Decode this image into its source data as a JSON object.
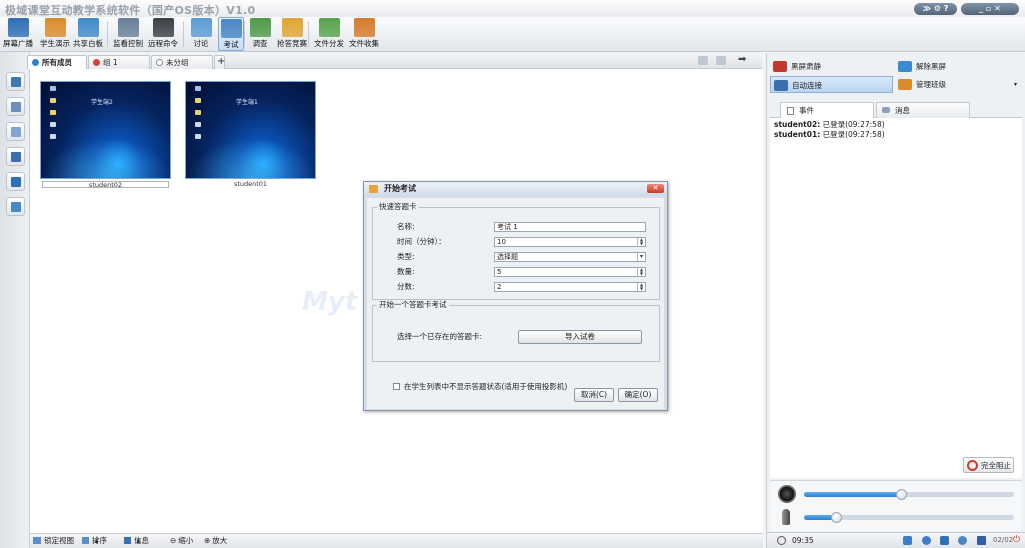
{
  "app": {
    "title": "极域课堂互动教学系统软件（国产OS版本）V1.0"
  },
  "window_controls": [
    {
      "name": "collapse-icon",
      "glyph": "≫"
    },
    {
      "name": "gear-icon",
      "glyph": "⚙"
    },
    {
      "name": "help-icon",
      "glyph": "?"
    },
    {
      "name": "minimize-icon",
      "glyph": "_"
    },
    {
      "name": "restore-icon",
      "glyph": "▫"
    },
    {
      "name": "close-icon",
      "glyph": "✕"
    }
  ],
  "toolbar": {
    "items": [
      {
        "label": "屏幕广播",
        "icon": "broadcast-icon",
        "color": "#2f6fb5"
      },
      {
        "label": "学生演示",
        "icon": "student-demo-icon",
        "color": "#d98b2b"
      },
      {
        "label": "共享白板",
        "icon": "whiteboard-icon",
        "color": "#3d8ac9"
      },
      {
        "label": "监看控制",
        "icon": "monitor-control-icon",
        "color": "#6a7f96"
      },
      {
        "label": "远程命令",
        "icon": "remote-command-icon",
        "color": "#3b4046"
      },
      {
        "label": "讨论",
        "icon": "discussion-icon",
        "color": "#5b9bd5"
      },
      {
        "label": "考试",
        "icon": "exam-icon",
        "color": "#4b86c7"
      },
      {
        "label": "调查",
        "icon": "survey-icon",
        "color": "#4e9a48"
      },
      {
        "label": "抢答竞赛",
        "icon": "quiz-icon",
        "color": "#e0a531"
      },
      {
        "label": "文件分发",
        "icon": "file-send-icon",
        "color": "#58a34c"
      },
      {
        "label": "文件收集",
        "icon": "file-collect-icon",
        "color": "#d67a2c"
      }
    ]
  },
  "tabs": [
    {
      "label": "所有成员",
      "color": "#2f7fd0"
    },
    {
      "label": "组 1",
      "color": "#d9413a"
    },
    {
      "label": "未分组",
      "color": "#8a8f96"
    }
  ],
  "tab_add": "+",
  "students": [
    {
      "screen_name": "学生端2",
      "caption": "student02"
    },
    {
      "screen_name": "学生端1",
      "caption": "student01"
    }
  ],
  "watermark": "Myt",
  "statusbar": {
    "lock_view": "锁定视图",
    "sort": "排序",
    "info": "信息",
    "zoom_out": "缩小",
    "zoom_in": "放大"
  },
  "right_panel": {
    "buttons": [
      {
        "label": "黑屏肃静",
        "icon": "black-screen-icon",
        "color": "#c0392b"
      },
      {
        "label": "解除黑屏",
        "icon": "unblack-screen-icon",
        "color": "#3b8bd4"
      },
      {
        "label": "自动连接",
        "icon": "auto-connect-icon",
        "color": "#3a6fb0"
      },
      {
        "label": "管理班级",
        "icon": "manage-class-icon",
        "color": "#d98b2b"
      }
    ],
    "event_tabs": [
      "事件",
      "消息"
    ],
    "events": [
      {
        "user": "student02:",
        "text": " 已登录(09:27:58)"
      },
      {
        "user": "student01:",
        "text": " 已登录(09:27:58)"
      }
    ],
    "stop_all": "完全阻止",
    "speaker_volume": 0.46,
    "mic_volume": 0.15,
    "time": "09:35",
    "count": "02/02"
  },
  "dialog": {
    "title": "开始考试",
    "close": "✕",
    "quick_card_label": "快速答题卡",
    "fields": {
      "name_label": "名称:",
      "name_value": "考试 1",
      "time_label": "时间（分钟）：",
      "time_value": "10",
      "type_label": "类型:",
      "type_value": "选择题",
      "count_label": "数量:",
      "count_value": "5",
      "score_label": "分数:",
      "score_value": "2"
    },
    "existing_label": "开始一个答题卡考试",
    "choose_label": "选择一个已存在的答题卡:",
    "import_button": "导入试卷",
    "checkbox_label": "在学生列表中不显示答题状态(适用于使用投影机)",
    "cancel_button": "取消(C)",
    "ok_button": "确定(O)"
  }
}
